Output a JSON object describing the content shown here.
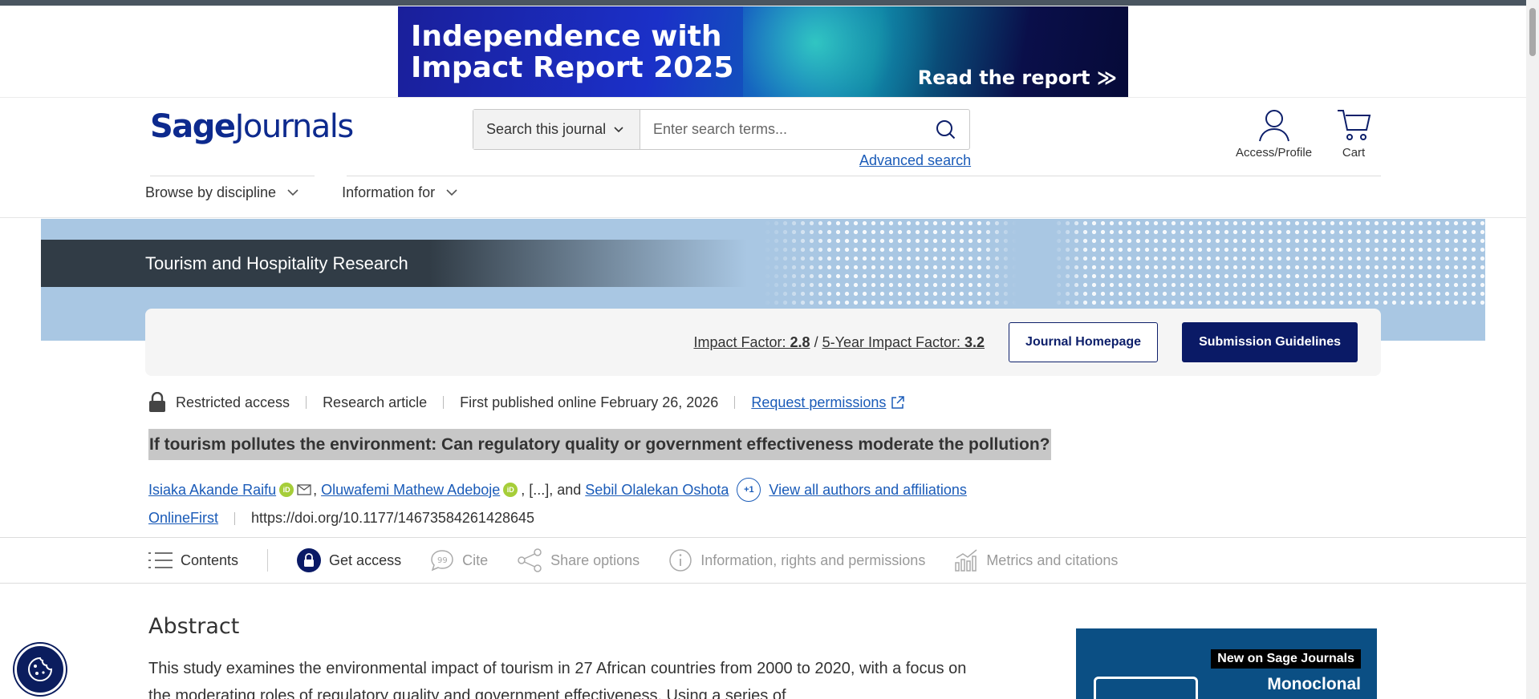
{
  "ad_banner": {
    "title": "Independence with Impact Report 2025",
    "cta": "Read the report ≫"
  },
  "header": {
    "logo_bold": "Sage",
    "logo_light": "Journals",
    "search_scope": "Search this journal",
    "search_placeholder": "Enter search terms...",
    "advanced_search": "Advanced search",
    "access_profile": "Access/Profile",
    "cart": "Cart"
  },
  "nav": {
    "browse": "Browse by discipline",
    "information": "Information for"
  },
  "journal": {
    "name": "Tourism and Hospitality Research",
    "impact_label": "Impact Factor:",
    "impact_value": "2.8",
    "slash": "/",
    "five_year_label": "5-Year Impact Factor:",
    "five_year_value": "3.2",
    "homepage_button": "Journal Homepage",
    "submission_button": "Submission Guidelines"
  },
  "article": {
    "access": "Restricted access",
    "type": "Research article",
    "published": "First published online February 26, 2026",
    "permissions": "Request permissions",
    "title": "If tourism pollutes the environment: Can regulatory quality or government effectiveness moderate the pollution?",
    "authors": {
      "author1": "Isiaka Akande Raifu",
      "author2": "Oluwafemi Mathew Adeboje",
      "ellipsis": ", [...], and ",
      "author3": "Sebil Olalekan Oshota",
      "more_badge": "+1",
      "view_all": "View all authors and affiliations"
    },
    "status": "OnlineFirst",
    "doi": "https://doi.org/10.1177/14673584261428645"
  },
  "tabs": {
    "contents": "Contents",
    "get_access": "Get access",
    "cite": "Cite",
    "share": "Share options",
    "info": "Information, rights and permissions",
    "metrics": "Metrics and citations"
  },
  "abstract": {
    "heading": "Abstract",
    "text": "This study examines the environmental impact of tourism in 27 African countries from 2000 to 2020, with a focus on the moderating roles of regulatory quality and government effectiveness. Using a series of"
  },
  "side_ad": {
    "badge": "New on Sage Journals",
    "subtitle": "Monoclonal"
  },
  "colors": {
    "brand_navy": "#0a1a66",
    "link_blue": "#1a5bb8",
    "banner_blue": "#a9c7e3"
  }
}
